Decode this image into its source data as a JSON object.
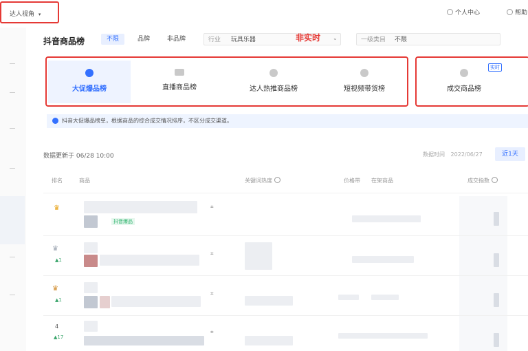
{
  "topbar": {
    "dropdown_label": "达人视角",
    "dropdown_arrow": "▾",
    "links": [
      {
        "label": "个人中心",
        "icon": "user-icon"
      },
      {
        "label": "帮助",
        "icon": "help-icon"
      }
    ]
  },
  "header": {
    "title": "抖音商品榜",
    "filters": [
      {
        "label": "不限",
        "active": true
      },
      {
        "label": "品牌",
        "active": false
      },
      {
        "label": "非品牌",
        "active": false
      }
    ],
    "industry_label": "行业",
    "industry_value": "玩具乐器",
    "realtime_label": "非实时",
    "category_label": "一级类目",
    "category_value": "不限"
  },
  "cards_left": [
    {
      "label": "大促爆品榜",
      "icon": "pie-icon",
      "active": true
    },
    {
      "label": "直播商品榜",
      "icon": "video-icon",
      "active": false
    },
    {
      "label": "达人热推商品榜",
      "icon": "star-icon",
      "active": false
    },
    {
      "label": "短视频带货榜",
      "icon": "play-icon",
      "active": false
    }
  ],
  "cards_right": [
    {
      "label": "成交商品榜",
      "icon": "hammer-icon",
      "tag": "实时",
      "active": false
    }
  ],
  "notice": {
    "text": "抖音大促爆品榜单，根据商品的综合成交情况排序，不区分成交渠道。"
  },
  "meta": {
    "updated": "数据更新于 06/28 10:00",
    "date_label": "数据时间",
    "date_value": "2022/06/27",
    "range_button": "近1天"
  },
  "table": {
    "headers": [
      "排名",
      "商品",
      "关键词热度",
      "价格带",
      "在架商品",
      "成交指数"
    ],
    "rows": [
      {
        "rank": "♛",
        "change": "",
        "tag": "抖音爆品"
      },
      {
        "rank": "♛",
        "change": "▲1",
        "tag": ""
      },
      {
        "rank": "♛",
        "change": "▲1",
        "tag": ""
      },
      {
        "rank": "4",
        "change": "▲17",
        "tag": ""
      }
    ]
  },
  "colors": {
    "accent": "#3370ff",
    "highlight": "#e53935"
  }
}
